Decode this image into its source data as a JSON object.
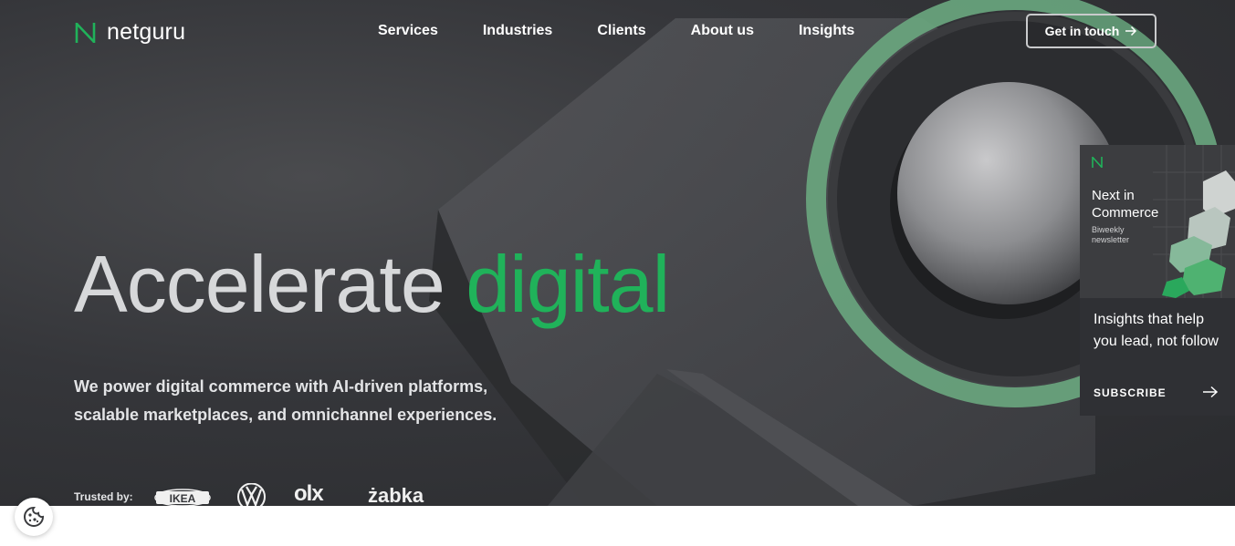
{
  "brand": {
    "name": "netguru"
  },
  "nav": {
    "items": [
      {
        "label": "Services"
      },
      {
        "label": "Industries"
      },
      {
        "label": "Clients"
      },
      {
        "label": "About us"
      },
      {
        "label": "Insights"
      }
    ],
    "cta_label": "Get in touch"
  },
  "hero": {
    "headline_part1": "Accelerate",
    "headline_part2": "digital",
    "subtitle": "We power digital commerce with AI-driven platforms, scalable marketplaces, and omnichannel experiences.",
    "trusted_label": "Trusted by:",
    "logos": [
      "IKEA",
      "VW",
      "olx",
      "żabka"
    ]
  },
  "newsletter": {
    "title": "Next in Commerce",
    "tag": "Biweekly newsletter",
    "body": "Insights that help you lead, not follow",
    "subscribe_label": "SUBSCRIBE"
  },
  "colors": {
    "accent_green": "#20b25a",
    "hero_bg": "#35363a",
    "card_bg": "#2f3034"
  },
  "icons": {
    "logo": "netguru-n-icon",
    "cta": "arrow-right-icon",
    "cookie": "cookie-icon"
  }
}
